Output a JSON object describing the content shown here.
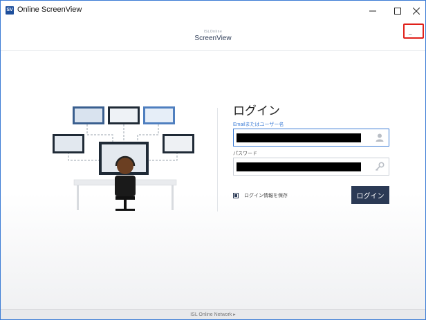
{
  "window": {
    "title": "Online ScreenView",
    "app_icon_text": "SV"
  },
  "header": {
    "logo_small": "ISLOnline",
    "logo": "ScreenView",
    "highlight_glyph": "_"
  },
  "login": {
    "title": "ログイン",
    "email_label": "Emailまたはユーザー名",
    "password_label": "パスワード",
    "remember_label": "ログイン情報を保存",
    "login_button": "ログイン"
  },
  "footer": {
    "text": "ISL Online Network ▸"
  },
  "colors": {
    "accent": "#3a7bd5",
    "button": "#2b3a55",
    "highlight": "#e0201a"
  }
}
